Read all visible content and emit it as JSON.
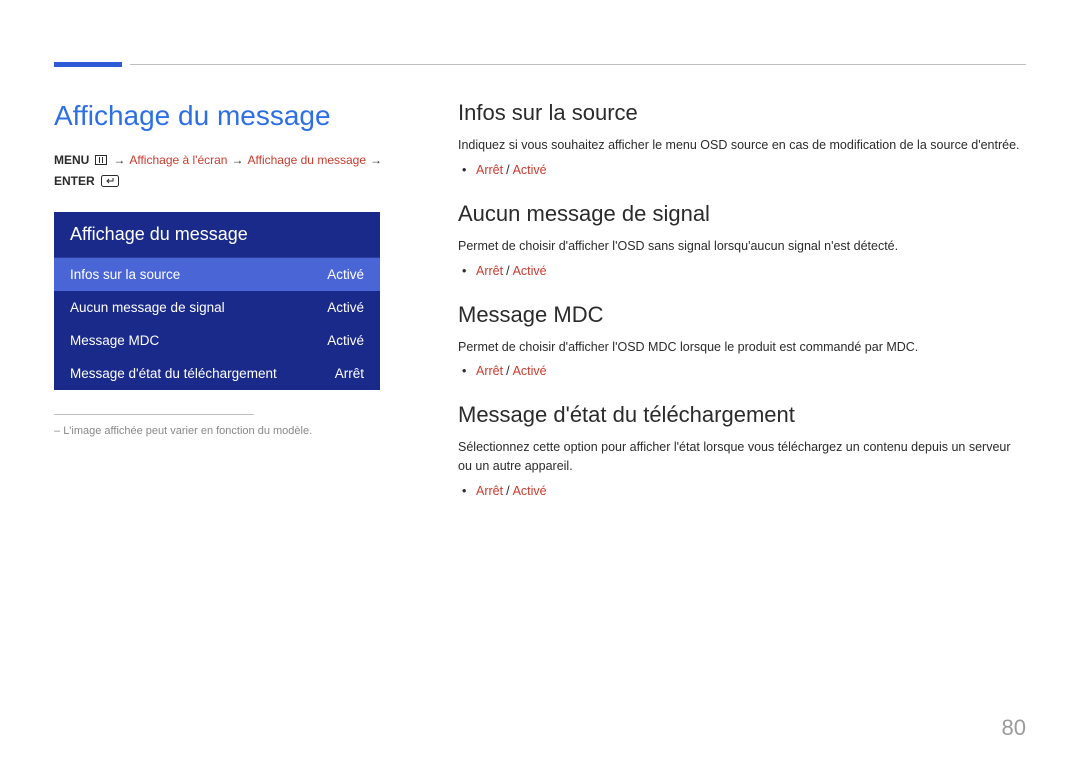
{
  "colors": {
    "accent": "#2d6fe4",
    "panel": "#1a2a8b",
    "panel_sel": "#4a66d6",
    "opt": "#cc3a2e"
  },
  "main_title": "Affichage du message",
  "breadcrumb": {
    "menu": "MENU",
    "p1": "Affichage à l'écran",
    "p2": "Affichage du message",
    "enter": "ENTER"
  },
  "osd": {
    "title": "Affichage du message",
    "rows": [
      {
        "label": "Infos sur la source",
        "value": "Activé",
        "selected": true
      },
      {
        "label": "Aucun message de signal",
        "value": "Activé",
        "selected": false
      },
      {
        "label": "Message MDC",
        "value": "Activé",
        "selected": false
      },
      {
        "label": "Message d'état du téléchargement",
        "value": "Arrêt",
        "selected": false
      }
    ]
  },
  "footnote": "L'image affichée peut varier en fonction du modèle.",
  "sections": [
    {
      "heading": "Infos sur la source",
      "desc": "Indiquez si vous souhaitez afficher le menu OSD source en cas de modification de la source d'entrée.",
      "options": [
        "Arrêt",
        "Activé"
      ]
    },
    {
      "heading": "Aucun message de signal",
      "desc": "Permet de choisir d'afficher l'OSD sans signal lorsqu'aucun signal n'est détecté.",
      "options": [
        "Arrêt",
        "Activé"
      ]
    },
    {
      "heading": "Message MDC",
      "desc": "Permet de choisir d'afficher l'OSD MDC lorsque le produit est commandé par MDC.",
      "options": [
        "Arrêt",
        "Activé"
      ]
    },
    {
      "heading": "Message d'état du téléchargement",
      "desc": "Sélectionnez cette option pour afficher l'état lorsque vous téléchargez un contenu depuis un serveur ou un autre appareil.",
      "options": [
        "Arrêt",
        "Activé"
      ]
    }
  ],
  "page_number": "80"
}
